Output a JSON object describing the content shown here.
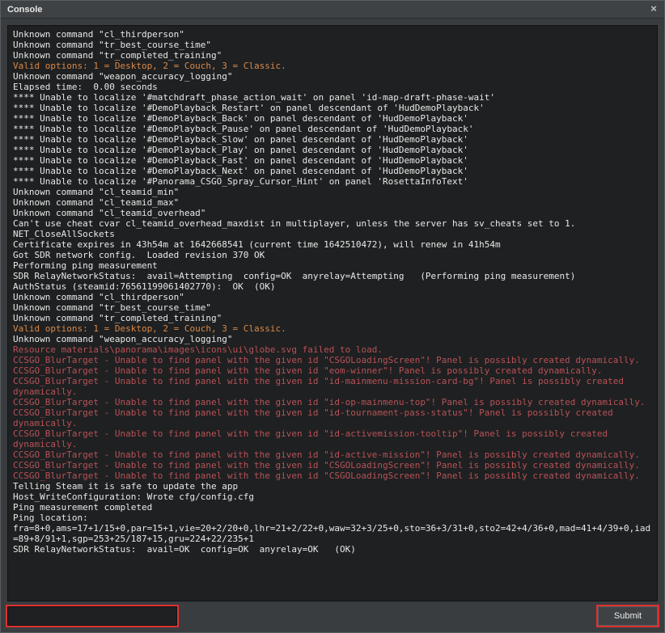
{
  "window": {
    "title": "Console",
    "close_glyph": "×"
  },
  "input": {
    "value": "",
    "placeholder": ""
  },
  "buttons": {
    "submit": "Submit"
  },
  "log": [
    {
      "c": "white",
      "t": "Unknown command \"cl_thirdperson\""
    },
    {
      "c": "white",
      "t": "Unknown command \"tr_best_course_time\""
    },
    {
      "c": "white",
      "t": "Unknown command \"tr_completed_training\""
    },
    {
      "c": "orange",
      "t": "Valid options: 1 = Desktop, 2 = Couch, 3 = Classic."
    },
    {
      "c": "white",
      "t": "Unknown command \"weapon_accuracy_logging\""
    },
    {
      "c": "white",
      "t": "Elapsed time:  0.00 seconds"
    },
    {
      "c": "white",
      "t": "**** Unable to localize '#matchdraft_phase_action_wait' on panel 'id-map-draft-phase-wait'"
    },
    {
      "c": "white",
      "t": "**** Unable to localize '#DemoPlayback_Restart' on panel descendant of 'HudDemoPlayback'"
    },
    {
      "c": "white",
      "t": "**** Unable to localize '#DemoPlayback_Back' on panel descendant of 'HudDemoPlayback'"
    },
    {
      "c": "white",
      "t": "**** Unable to localize '#DemoPlayback_Pause' on panel descendant of 'HudDemoPlayback'"
    },
    {
      "c": "white",
      "t": "**** Unable to localize '#DemoPlayback_Slow' on panel descendant of 'HudDemoPlayback'"
    },
    {
      "c": "white",
      "t": "**** Unable to localize '#DemoPlayback_Play' on panel descendant of 'HudDemoPlayback'"
    },
    {
      "c": "white",
      "t": "**** Unable to localize '#DemoPlayback_Fast' on panel descendant of 'HudDemoPlayback'"
    },
    {
      "c": "white",
      "t": "**** Unable to localize '#DemoPlayback_Next' on panel descendant of 'HudDemoPlayback'"
    },
    {
      "c": "white",
      "t": "**** Unable to localize '#Panorama_CSGO_Spray_Cursor_Hint' on panel 'RosettaInfoText'"
    },
    {
      "c": "white",
      "t": "Unknown command \"cl_teamid_min\""
    },
    {
      "c": "white",
      "t": "Unknown command \"cl_teamid_max\""
    },
    {
      "c": "white",
      "t": "Unknown command \"cl_teamid_overhead\""
    },
    {
      "c": "white",
      "t": "Can't use cheat cvar cl_teamid_overhead_maxdist in multiplayer, unless the server has sv_cheats set to 1."
    },
    {
      "c": "white",
      "t": "NET_CloseAllSockets"
    },
    {
      "c": "white",
      "t": "Certificate expires in 43h54m at 1642668541 (current time 1642510472), will renew in 41h54m"
    },
    {
      "c": "white",
      "t": "Got SDR network config.  Loaded revision 370 OK"
    },
    {
      "c": "white",
      "t": "Performing ping measurement"
    },
    {
      "c": "white",
      "t": "SDR RelayNetworkStatus:  avail=Attempting  config=OK  anyrelay=Attempting   (Performing ping measurement)"
    },
    {
      "c": "white",
      "t": "AuthStatus (steamid:76561199061402770):  OK  (OK)"
    },
    {
      "c": "white",
      "t": "Unknown command \"cl_thirdperson\""
    },
    {
      "c": "white",
      "t": "Unknown command \"tr_best_course_time\""
    },
    {
      "c": "white",
      "t": "Unknown command \"tr_completed_training\""
    },
    {
      "c": "orange",
      "t": "Valid options: 1 = Desktop, 2 = Couch, 3 = Classic."
    },
    {
      "c": "white",
      "t": "Unknown command \"weapon_accuracy_logging\""
    },
    {
      "c": "red",
      "t": "Resource materials\\panorama\\images\\icons\\ui\\globe.svg failed to load."
    },
    {
      "c": "red",
      "t": "CCSGO_BlurTarget - Unable to find panel with the given id \"CSGOLoadingScreen\"! Panel is possibly created dynamically."
    },
    {
      "c": "red",
      "t": "CCSGO_BlurTarget - Unable to find panel with the given id \"eom-winner\"! Panel is possibly created dynamically."
    },
    {
      "c": "red",
      "t": "CCSGO_BlurTarget - Unable to find panel with the given id \"id-mainmenu-mission-card-bg\"! Panel is possibly created dynamically."
    },
    {
      "c": "red",
      "t": "CCSGO_BlurTarget - Unable to find panel with the given id \"id-op-mainmenu-top\"! Panel is possibly created dynamically."
    },
    {
      "c": "red",
      "t": "CCSGO_BlurTarget - Unable to find panel with the given id \"id-tournament-pass-status\"! Panel is possibly created dynamically."
    },
    {
      "c": "red",
      "t": "CCSGO_BlurTarget - Unable to find panel with the given id \"id-activemission-tooltip\"! Panel is possibly created dynamically."
    },
    {
      "c": "red",
      "t": "CCSGO_BlurTarget - Unable to find panel with the given id \"id-active-mission\"! Panel is possibly created dynamically."
    },
    {
      "c": "red",
      "t": "CCSGO_BlurTarget - Unable to find panel with the given id \"CSGOLoadingScreen\"! Panel is possibly created dynamically."
    },
    {
      "c": "red",
      "t": "CCSGO_BlurTarget - Unable to find panel with the given id \"CSGOLoadingScreen\"! Panel is possibly created dynamically."
    },
    {
      "c": "white",
      "t": "Telling Steam it is safe to update the app"
    },
    {
      "c": "white",
      "t": "Host_WriteConfiguration: Wrote cfg/config.cfg"
    },
    {
      "c": "white",
      "t": "Ping measurement completed"
    },
    {
      "c": "white",
      "t": "Ping location: fra=8+0,ams=17+1/15+0,par=15+1,vie=20+2/20+0,lhr=21+2/22+0,waw=32+3/25+0,sto=36+3/31+0,sto2=42+4/36+0,mad=41+4/39+0,iad=89+8/91+1,sgp=253+25/187+15,gru=224+22/235+1"
    },
    {
      "c": "white",
      "t": "SDR RelayNetworkStatus:  avail=OK  config=OK  anyrelay=OK   (OK)"
    }
  ]
}
